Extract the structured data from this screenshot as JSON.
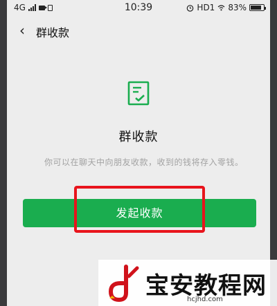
{
  "status_bar": {
    "network": "4G",
    "time": "10:39",
    "hd_label": "HD1",
    "battery": "83%",
    "icons": [
      "signal-icon",
      "camera-icon",
      "sd-card-icon",
      "alarm-icon",
      "battery-icon"
    ]
  },
  "nav": {
    "back_icon": "chevron-left-icon",
    "title": "群收款"
  },
  "main": {
    "icon": "document-check-icon",
    "title": "群收款",
    "description": "你可以在聊天中向朋友收款，收到的钱将存入零钱。",
    "button_label": "发起收款"
  },
  "watermark": {
    "logo": "baoan-logo",
    "text": "宝安教程网",
    "url": "hcjhd.com"
  },
  "colors": {
    "accent": "#1aad4f",
    "highlight": "#e8141c",
    "background": "#ededed"
  }
}
